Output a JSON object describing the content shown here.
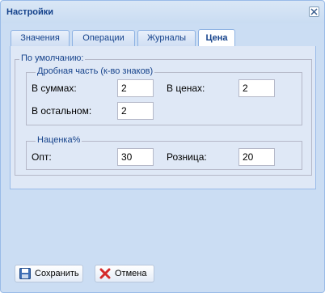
{
  "window": {
    "title": "Настройки"
  },
  "tabs": [
    {
      "label": "Значения"
    },
    {
      "label": "Операции"
    },
    {
      "label": "Журналы"
    },
    {
      "label": "Цена"
    }
  ],
  "active_tab": "Цена",
  "defaults": {
    "legend": "По умолчанию:",
    "fraction": {
      "legend": "Дробная часть (к-во знаков)",
      "sums_label": "В суммах:",
      "sums_value": "2",
      "prices_label": "В ценах:",
      "prices_value": "2",
      "other_label": "В остальном:",
      "other_value": "2"
    },
    "markup": {
      "legend": "Наценка%",
      "wholesale_label": "Опт:",
      "wholesale_value": "30",
      "retail_label": "Розница:",
      "retail_value": "20"
    }
  },
  "buttons": {
    "save": "Сохранить",
    "cancel": "Отмена"
  },
  "colors": {
    "title_text": "#15428b",
    "window_border": "#99bbe8",
    "window_bg": "#cbddf3",
    "panel_bg": "#dfe8f6"
  },
  "icons": {
    "close": "close-icon",
    "save": "floppy-disk-icon",
    "cancel": "red-x-icon"
  }
}
